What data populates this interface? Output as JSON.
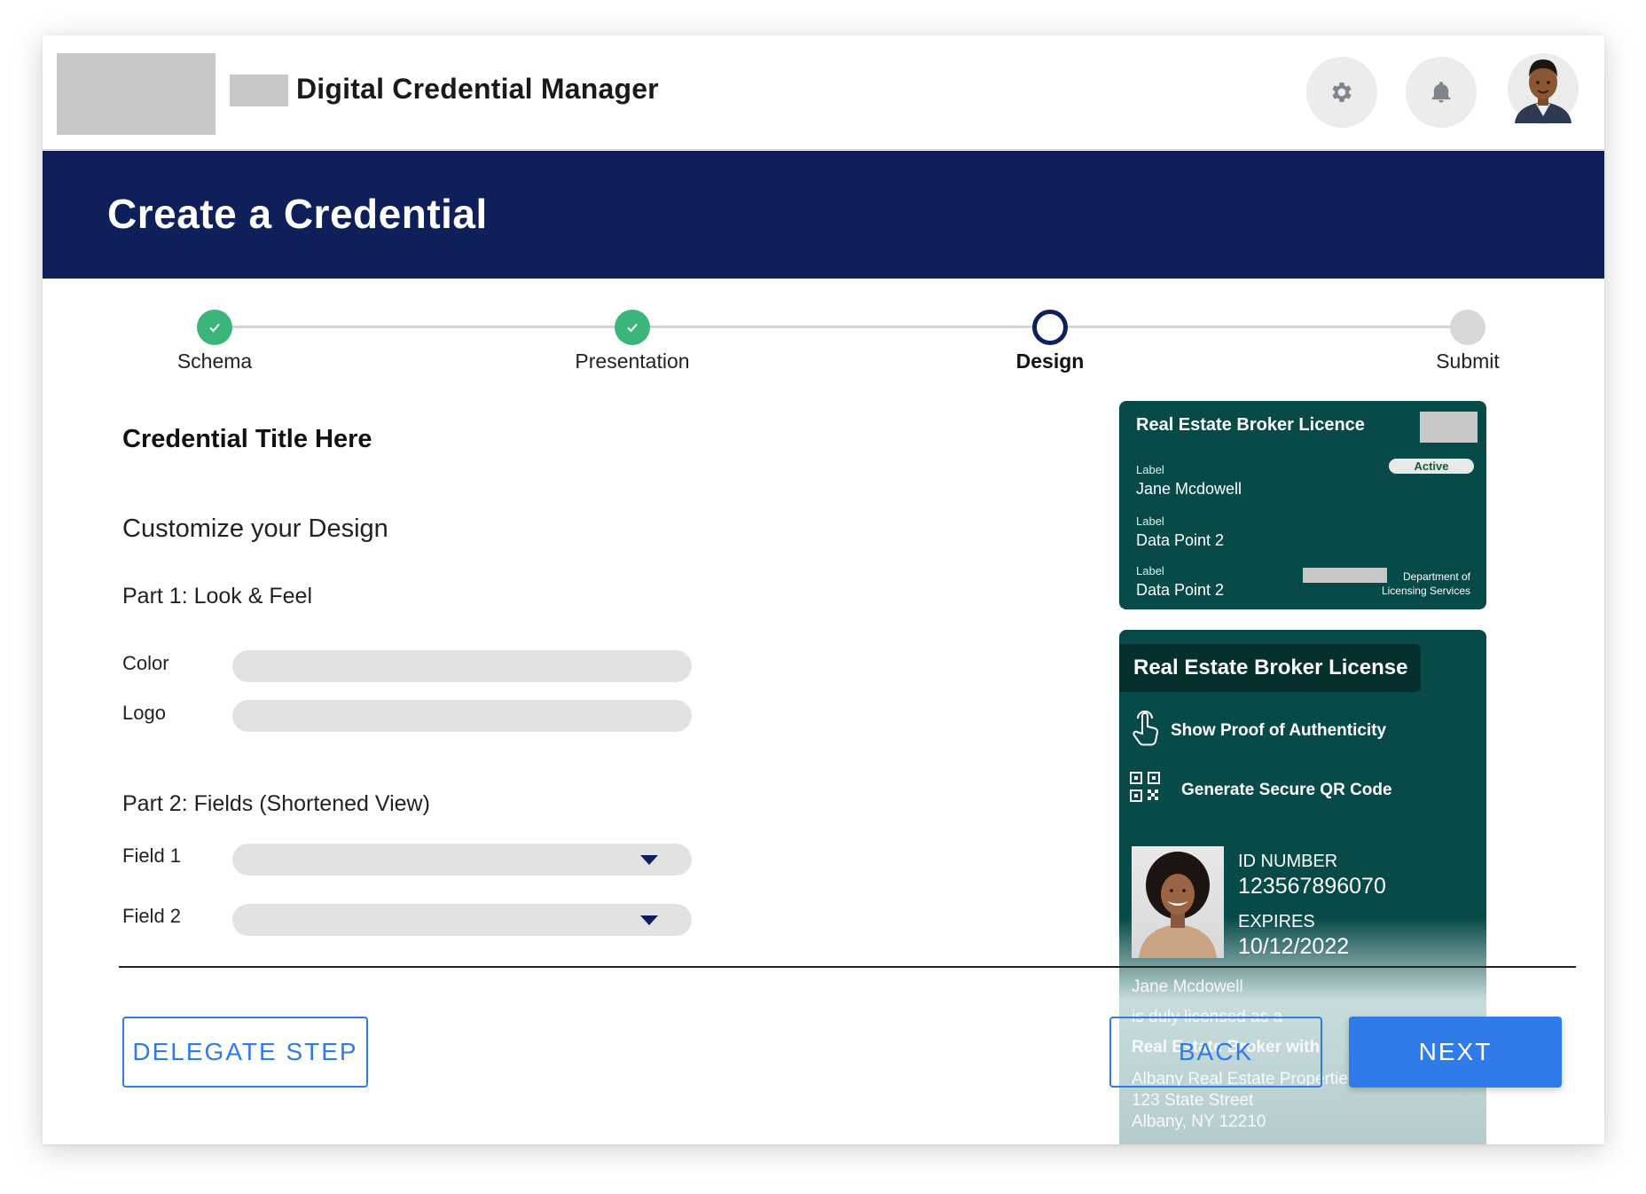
{
  "header": {
    "app_title": "Digital Credential Manager",
    "settings_icon": "gear-icon",
    "notifications_icon": "bell-icon",
    "avatar_icon": "user-avatar"
  },
  "banner": {
    "title": "Create a Credential"
  },
  "stepper": {
    "steps": [
      {
        "label": "Schema",
        "state": "done"
      },
      {
        "label": "Presentation",
        "state": "done"
      },
      {
        "label": "Design",
        "state": "current"
      },
      {
        "label": "Submit",
        "state": "todo"
      }
    ]
  },
  "form": {
    "credential_title": "Credential Title Here",
    "section_title": "Customize your Design",
    "part1_title": "Part 1: Look & Feel",
    "color_label": "Color",
    "logo_label": "Logo",
    "part2_title": "Part 2: Fields (Shortened View)",
    "field1_label": "Field 1",
    "field2_label": "Field 2"
  },
  "card_preview": {
    "title": "Real Estate Broker Licence",
    "status": "Active",
    "rows": [
      {
        "label": "Label",
        "value": "Jane Mcdowell"
      },
      {
        "label": "Label",
        "value": "Data Point 2"
      },
      {
        "label": "Label",
        "value": "Data Point 2"
      }
    ],
    "issuer_line1": "Department of",
    "issuer_line2": "Licensing Services"
  },
  "wallet_card": {
    "title": "Real Estate Broker License",
    "action1": "Show Proof of Authenticity",
    "action2": "Generate Secure QR Code",
    "id_label": "ID NUMBER",
    "id_value": "123567896070",
    "expires_label": "EXPIRES",
    "expires_value": "10/12/2022",
    "holder_name": "Jane Mcdowell",
    "licensed_line": "is duly licensed as a",
    "role_line": "Real Estate Broker with",
    "company": "Albany Real Estate Properties",
    "street": "123 State Street",
    "city": "Albany, NY 12210"
  },
  "footer": {
    "delegate_label": "DELEGATE STEP",
    "back_label": "BACK",
    "next_label": "NEXT"
  },
  "colors": {
    "banner": "#0f1f5a",
    "step_done": "#3bb57a",
    "card_green": "#074a47",
    "primary_blue": "#2f7bea"
  }
}
